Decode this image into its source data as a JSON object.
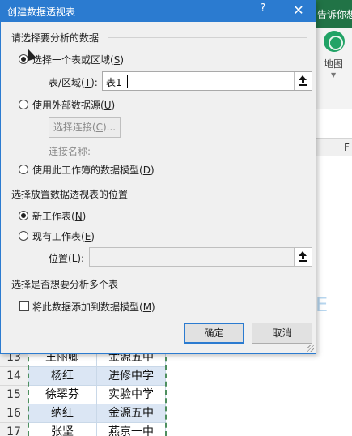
{
  "excel": {
    "ribbon_tell_me": "告诉你想要做",
    "map_label": "地图",
    "column_f": "F",
    "watermark_text": "E",
    "rows": [
      {
        "num": "13",
        "name": "王丽卿",
        "school": "金源五中"
      },
      {
        "num": "14",
        "name": "杨红",
        "school": "进修中学"
      },
      {
        "num": "15",
        "name": "徐翠芬",
        "school": "实验中学"
      },
      {
        "num": "16",
        "name": "纳红",
        "school": "金源五中"
      },
      {
        "num": "17",
        "name": "张坚",
        "school": "燕京一中"
      }
    ]
  },
  "dialog": {
    "title": "创建数据透视表",
    "help": "?",
    "close": "✕",
    "section1": "请选择要分析的数据",
    "opt_table_prefix": "选择一个表或区域(",
    "opt_table_key": "S",
    "opt_table_suffix": ")",
    "range_label_prefix": "表/区域(",
    "range_label_key": "T",
    "range_label_suffix": "):",
    "range_value": "表1",
    "opt_external_prefix": "使用外部数据源(",
    "opt_external_key": "U",
    "opt_external_suffix": ")",
    "choose_conn_prefix": "选择连接(",
    "choose_conn_key": "C",
    "choose_conn_suffix": ")...",
    "conn_name_label": "连接名称:",
    "opt_model_prefix": "使用此工作簿的数据模型(",
    "opt_model_key": "D",
    "opt_model_suffix": ")",
    "section2": "选择放置数据透视表的位置",
    "opt_new_prefix": "新工作表(",
    "opt_new_key": "N",
    "opt_new_suffix": ")",
    "opt_existing_prefix": "现有工作表(",
    "opt_existing_key": "E",
    "opt_existing_suffix": ")",
    "location_prefix": "位置(",
    "location_key": "L",
    "location_suffix": "):",
    "location_value": "",
    "section3": "选择是否想要分析多个表",
    "add_model_prefix": "将此数据添加到数据模型(",
    "add_model_key": "M",
    "add_model_suffix": ")",
    "ok": "确定",
    "cancel": "取消"
  },
  "colors": {
    "title_bar": "#2b7bd0",
    "excel_green": "#217346",
    "dialog_bg": "#f0f0f0"
  }
}
